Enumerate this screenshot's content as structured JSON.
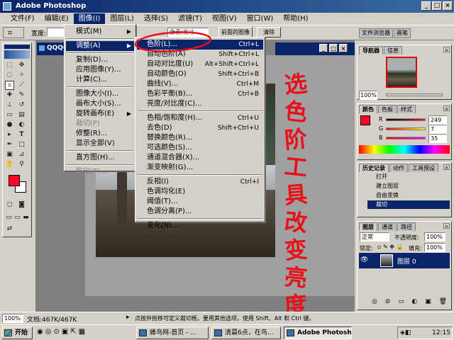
{
  "window": {
    "title": "Adobe Photoshop",
    "minimize": "_",
    "maximize": "□",
    "close": "×"
  },
  "menubar": [
    {
      "label": "文件(F)"
    },
    {
      "label": "编辑(E)"
    },
    {
      "label": "图像(I)"
    },
    {
      "label": "图层(L)"
    },
    {
      "label": "选择(S)"
    },
    {
      "label": "滤镜(T)"
    },
    {
      "label": "视图(V)"
    },
    {
      "label": "窗口(W)"
    },
    {
      "label": "帮助(H)"
    }
  ],
  "options_bar": {
    "width_label": "宽度:",
    "front_image_button": "前面的图像",
    "clear_button": "清除",
    "units_value": "像素/英寸",
    "file_browser_tab": "文件浏览器",
    "brushes_tab": "画笔"
  },
  "document": {
    "title": "QQQQ"
  },
  "image_menu": [
    {
      "label": "模式(M)",
      "submenu": true
    },
    {
      "sep": true
    },
    {
      "label": "调整(A)",
      "submenu": true,
      "highlight": true
    },
    {
      "sep": true
    },
    {
      "label": "复制(D)..."
    },
    {
      "label": "应用图像(Y)..."
    },
    {
      "label": "计算(C)..."
    },
    {
      "sep": true
    },
    {
      "label": "图像大小(I)..."
    },
    {
      "label": "画布大小(S)..."
    },
    {
      "label": "旋转画布(E)",
      "submenu": true
    },
    {
      "label": "裁切(P)",
      "disabled": true
    },
    {
      "label": "修整(R)..."
    },
    {
      "label": "显示全部(V)"
    },
    {
      "sep": true
    },
    {
      "label": "直方图(H)..."
    },
    {
      "sep": true
    },
    {
      "label": "陷印(T)...",
      "disabled": true
    }
  ],
  "adjust_menu": [
    {
      "label": "色阶(L)...",
      "shortcut": "Ctrl+L",
      "highlight": true
    },
    {
      "label": "自动色阶(A)",
      "shortcut": "Shift+Ctrl+L"
    },
    {
      "label": "自动对比度(U)",
      "shortcut": "Alt+Shift+Ctrl+L"
    },
    {
      "label": "自动颜色(O)",
      "shortcut": "Shift+Ctrl+B"
    },
    {
      "label": "曲线(V)...",
      "shortcut": "Ctrl+M"
    },
    {
      "label": "色彩平衡(B)...",
      "shortcut": "Ctrl+B"
    },
    {
      "label": "亮度/对比度(C)...",
      "shortcut": ""
    },
    {
      "sep": true
    },
    {
      "label": "色相/饱和度(H)...",
      "shortcut": "Ctrl+U"
    },
    {
      "label": "去色(D)",
      "shortcut": "Shift+Ctrl+U"
    },
    {
      "label": "替换颜色(R)...",
      "shortcut": ""
    },
    {
      "label": "可选颜色(S)...",
      "shortcut": ""
    },
    {
      "label": "通道混合器(X)...",
      "shortcut": ""
    },
    {
      "label": "渐变映射(G)...",
      "shortcut": ""
    },
    {
      "sep": true
    },
    {
      "label": "反相(I)",
      "shortcut": "Ctrl+I"
    },
    {
      "label": "色调均化(E)",
      "shortcut": ""
    },
    {
      "label": "阈值(T)...",
      "shortcut": ""
    },
    {
      "label": "色调分离(P)...",
      "shortcut": ""
    },
    {
      "sep": true
    },
    {
      "label": "变化(N)...",
      "shortcut": ""
    }
  ],
  "annotation": {
    "text": [
      "选",
      "色",
      "阶",
      "工",
      "具",
      "改",
      "变",
      "亮",
      "度"
    ],
    "color": "#e8101a"
  },
  "navigator": {
    "tabs": [
      "导航器",
      "信息"
    ],
    "zoom": "100%"
  },
  "color_palette": {
    "tabs": [
      "颜色",
      "色板",
      "样式"
    ],
    "channels": [
      {
        "label": "R",
        "value": "249"
      },
      {
        "label": "G",
        "value": "7"
      },
      {
        "label": "B",
        "value": "35"
      }
    ],
    "foreground": "#f90723"
  },
  "history": {
    "tabs": [
      "历史记录",
      "动作",
      "工具预设"
    ],
    "items": [
      "打开",
      "建立图层",
      "自由变换",
      "裁切"
    ]
  },
  "layers": {
    "tabs": [
      "图层",
      "通道",
      "路径"
    ],
    "blend_mode": "正常",
    "opacity_label": "不透明度:",
    "opacity": "100%",
    "lock_label": "锁定:",
    "fill_label": "填充:",
    "fill": "100%",
    "layer_name": "图层 0"
  },
  "statusbar": {
    "zoom": "100%",
    "doc": "文档:467K/467K",
    "hint": "点按并拖移可定义裁切框。要用其他选项，使用 Shift、Alt 和 Ctrl 键。"
  },
  "taskbar": {
    "start": "开始",
    "tasks": [
      "蜂鸟网-首页 - ...",
      "清晨6点，在鸟...",
      "Adobe Photoshop"
    ],
    "active_index": 2,
    "clock": "12:15"
  }
}
